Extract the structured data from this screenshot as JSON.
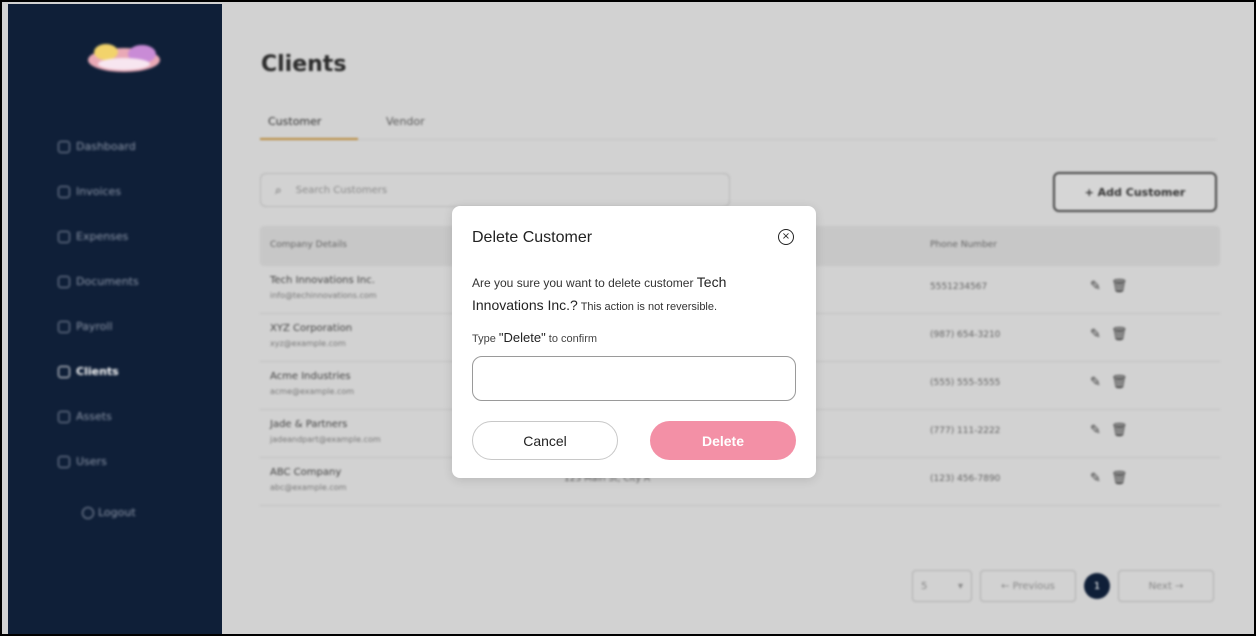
{
  "sidebar": {
    "items": [
      {
        "label": "Dashboard",
        "icon": "home-icon"
      },
      {
        "label": "Invoices",
        "icon": "invoice-icon"
      },
      {
        "label": "Expenses",
        "icon": "expenses-icon"
      },
      {
        "label": "Documents",
        "icon": "document-icon"
      },
      {
        "label": "Payroll",
        "icon": "payroll-icon"
      },
      {
        "label": "Clients",
        "icon": "clients-icon",
        "active": true
      },
      {
        "label": "Assets",
        "icon": "assets-icon"
      },
      {
        "label": "Users",
        "icon": "users-icon"
      }
    ],
    "logout": "Logout"
  },
  "page": {
    "title": "Clients",
    "tabs": [
      "Customer",
      "Vendor"
    ],
    "search_placeholder": "Search Customers",
    "add_button": "+ Add Customer",
    "columns": {
      "company": "Company Details",
      "phone": "Phone Number"
    },
    "rows": [
      {
        "name": "Tech Innovations Inc.",
        "email": "info@techinnovations.com",
        "address": "",
        "phone": "5551234567"
      },
      {
        "name": "XYZ Corporation",
        "email": "xyz@example.com",
        "address": "",
        "phone": "(987) 654-3210"
      },
      {
        "name": "Acme Industries",
        "email": "acme@example.com",
        "address": "",
        "phone": "(555) 555-5555"
      },
      {
        "name": "Jade & Partners",
        "email": "jadeandpart@example.com",
        "address": "",
        "phone": "(777) 111-2222"
      },
      {
        "name": "ABC Company",
        "email": "abc@example.com",
        "address": "123 Main St, City A",
        "phone": "(123) 456-7890"
      }
    ],
    "pagination": {
      "page_size": "5",
      "previous": "← Previous",
      "current_page": "1",
      "next": "Next →"
    }
  },
  "modal": {
    "title": "Delete Customer",
    "close_symbol": "×",
    "message_prefix": "Are you sure you want to delete customer ",
    "customer_name": "Tech Innovations Inc.?",
    "message_suffix": " This action is not reversible.",
    "type_prefix": "Type ",
    "type_keyword": "\"Delete\"",
    "type_suffix": " to confirm",
    "input_value": "",
    "cancel_label": "Cancel",
    "delete_label": "Delete",
    "delete_color": "#f390a6"
  },
  "colors": {
    "sidebar_bg": "#0f1f38",
    "tab_accent": "#b8893a"
  }
}
